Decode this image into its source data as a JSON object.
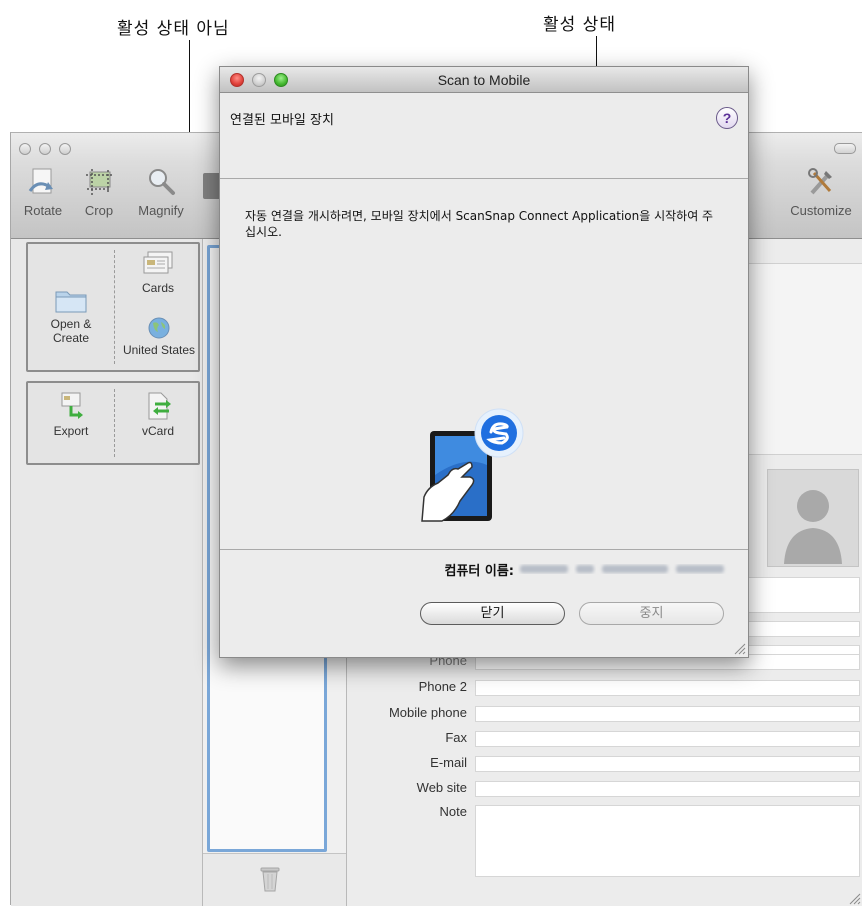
{
  "annotations": {
    "inactive": "활성 상태 아님",
    "active": "활성 상태"
  },
  "background_window": {
    "state": "inactive",
    "toolbar": {
      "items": [
        {
          "label": "Rotate",
          "icon": "rotate-icon"
        },
        {
          "label": "Crop",
          "icon": "crop-icon"
        },
        {
          "label": "Magnify",
          "icon": "magnify-icon"
        },
        {
          "label": "Customize",
          "icon": "customize-tools-icon"
        }
      ]
    },
    "left_panel": {
      "group1": [
        {
          "label": "Open & Create",
          "icon": "folder-icon"
        },
        {
          "label": "Cards",
          "icon": "cards-icon"
        },
        {
          "label": "United States",
          "icon": "globe-icon"
        }
      ],
      "group2": [
        {
          "label": "Export",
          "icon": "export-icon"
        },
        {
          "label": "vCard",
          "icon": "vcard-icon"
        }
      ]
    },
    "detail": {
      "photo_icon": "person-silhouette-icon",
      "fields": [
        {
          "label": "Phone"
        },
        {
          "label": "Phone 2"
        },
        {
          "label": "Mobile phone"
        },
        {
          "label": "Fax"
        },
        {
          "label": "E-mail"
        },
        {
          "label": "Web site"
        },
        {
          "label": "Note"
        }
      ]
    },
    "trash_icon": "trash-icon"
  },
  "dialog": {
    "title": "Scan to Mobile",
    "heading": "연결된 모바일 장치",
    "help_label": "?",
    "instruction": "자동 연결을 개시하려면, 모바일 장치에서 ScanSnap Connect Application을 시작하여 주십시오.",
    "computer_name_label": "컴퓨터 이름:",
    "computer_name_value_state": "blurred",
    "buttons": {
      "close": "닫기",
      "stop": "중지"
    },
    "illustration_icon": "tablet-touch-scansnap-icon",
    "colors": {
      "close_light": "#e0413a",
      "minimize_light": "#d0d0d0",
      "zoom_light": "#44b82f",
      "help_accent": "#5b2f97",
      "scansnap_blue": "#1f6fe0"
    }
  }
}
